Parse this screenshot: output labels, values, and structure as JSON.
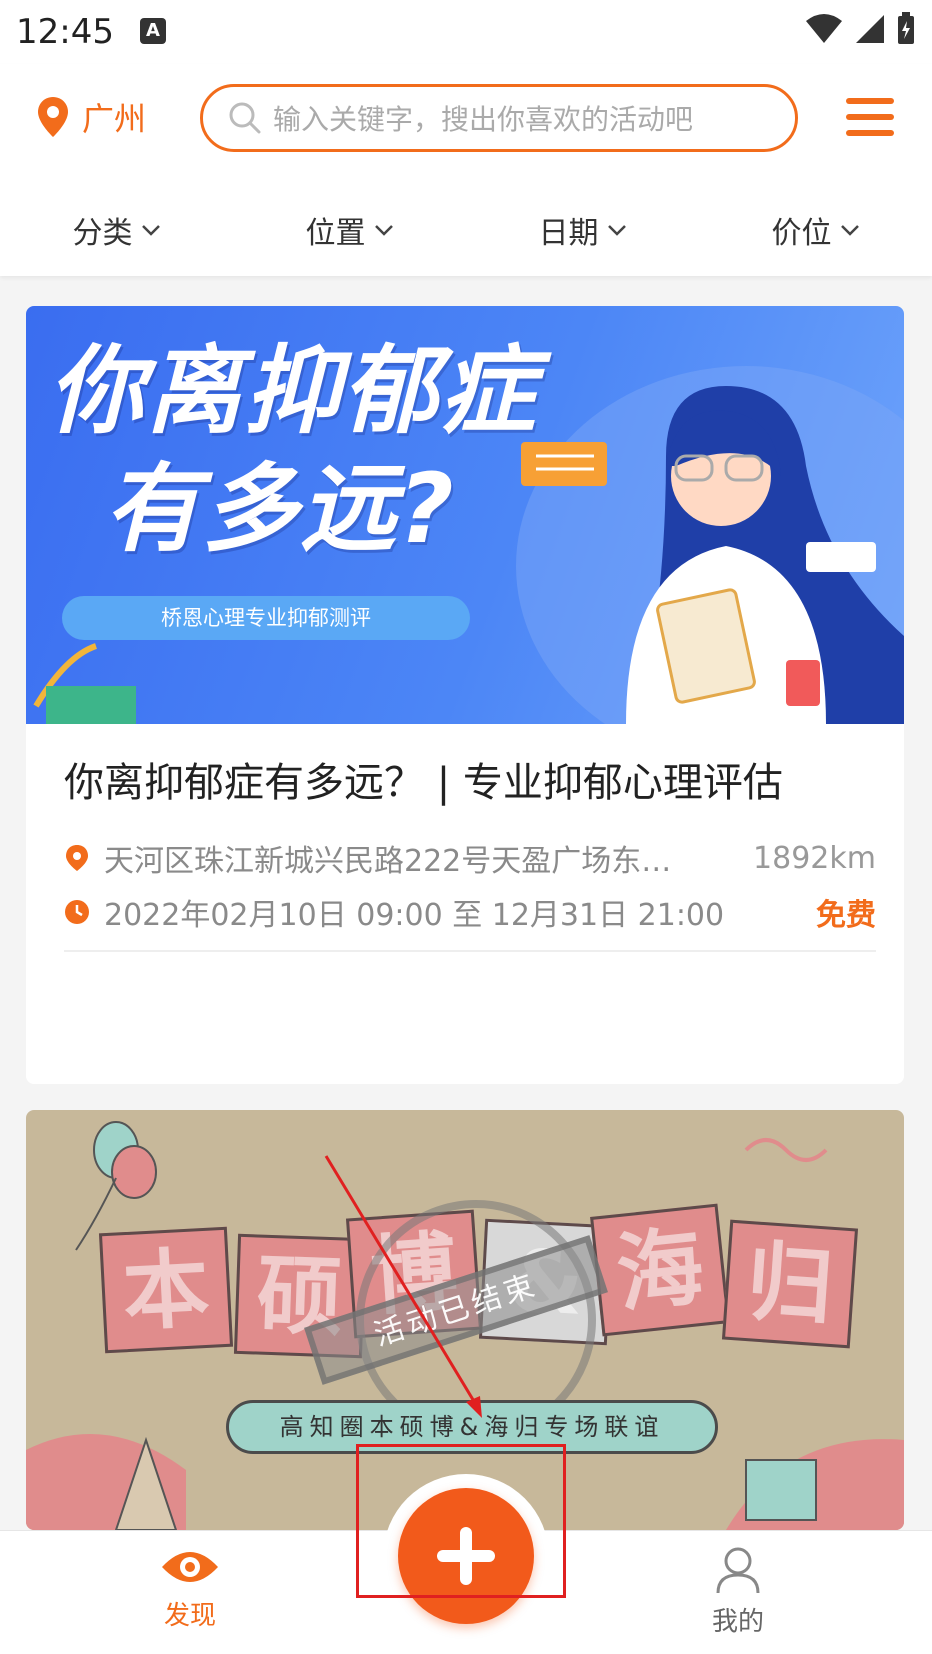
{
  "status_bar": {
    "time": "12:45",
    "a_label": "A"
  },
  "header": {
    "city": "广州",
    "search_placeholder": "输入关键字，搜出你喜欢的活动吧",
    "filters": [
      "分类",
      "位置",
      "日期",
      "价位"
    ]
  },
  "cards": [
    {
      "banner_title_line1": "你离抑郁症",
      "banner_title_line2": "有多远?",
      "banner_subtitle": "桥恩心理专业抑郁测评",
      "title": "你离抑郁症有多远？ | 专业抑郁心理评估",
      "address": "天河区珠江新城兴民路222号天盈广场东…",
      "distance": "1892km",
      "time": "2022年02月10日 09:00 至 12月31日 21:00",
      "price": "免费"
    },
    {
      "banner_chars": [
        "本",
        "硕",
        "博",
        "&",
        "海",
        "归"
      ],
      "banner_subtitle": "高知圈本硕博&海归专场联谊",
      "stamp": "活动已结束"
    }
  ],
  "bottom_nav": {
    "discover": "发现",
    "mine": "我的"
  },
  "colors": {
    "accent": "#f26c1b",
    "fab": "#f25a1b",
    "annotation": "#e02020"
  },
  "icons": [
    "location-pin-icon",
    "search-icon",
    "menu-icon",
    "chevron-down-icon",
    "clock-icon",
    "eye-icon",
    "plus-icon",
    "user-icon"
  ]
}
